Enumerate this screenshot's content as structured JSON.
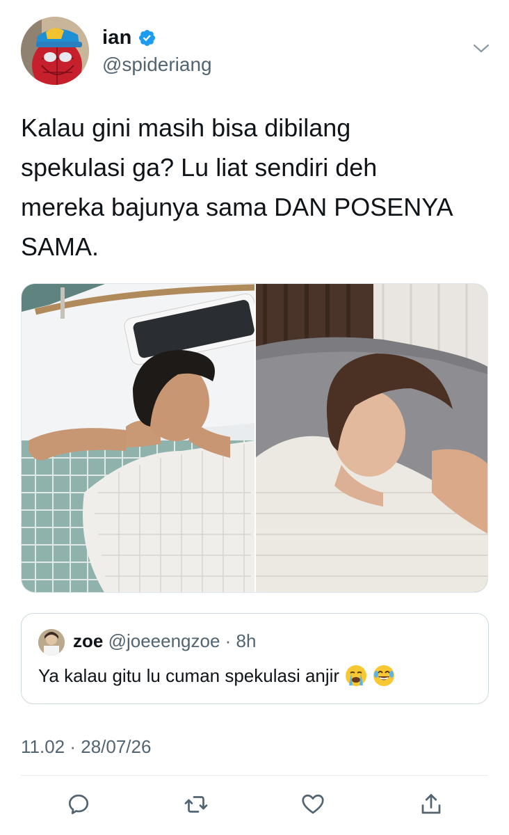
{
  "tweet": {
    "author": {
      "display_name": "ian",
      "handle": "@spideriang",
      "verified": true,
      "avatar": "spiderman-avatar"
    },
    "text_lines": [
      "Kalau gini masih bisa dibilang",
      "spekulasi ga? Lu liat sendiri deh",
      "mereka bajunya sama DAN POSENYA",
      "SAMA."
    ],
    "timestamp": "11.02 · 28/07/26",
    "media": [
      {
        "name": "photo-left"
      },
      {
        "name": "photo-right"
      }
    ]
  },
  "quoted_tweet": {
    "display_name": "zoe",
    "meta": " @joeeengzoe · 8h",
    "text": "Ya kalau gitu lu cuman spekulasi anjir",
    "emojis": [
      "loudly-crying-face",
      "face-with-tears-of-joy"
    ]
  },
  "actions": [
    {
      "name": "reply-icon"
    },
    {
      "name": "retweet-icon"
    },
    {
      "name": "like-icon"
    },
    {
      "name": "share-icon"
    }
  ],
  "colors": {
    "text": "#0f1419",
    "secondary": "#536471",
    "verified": "#1d9bf0",
    "border": "#cfd9de"
  }
}
